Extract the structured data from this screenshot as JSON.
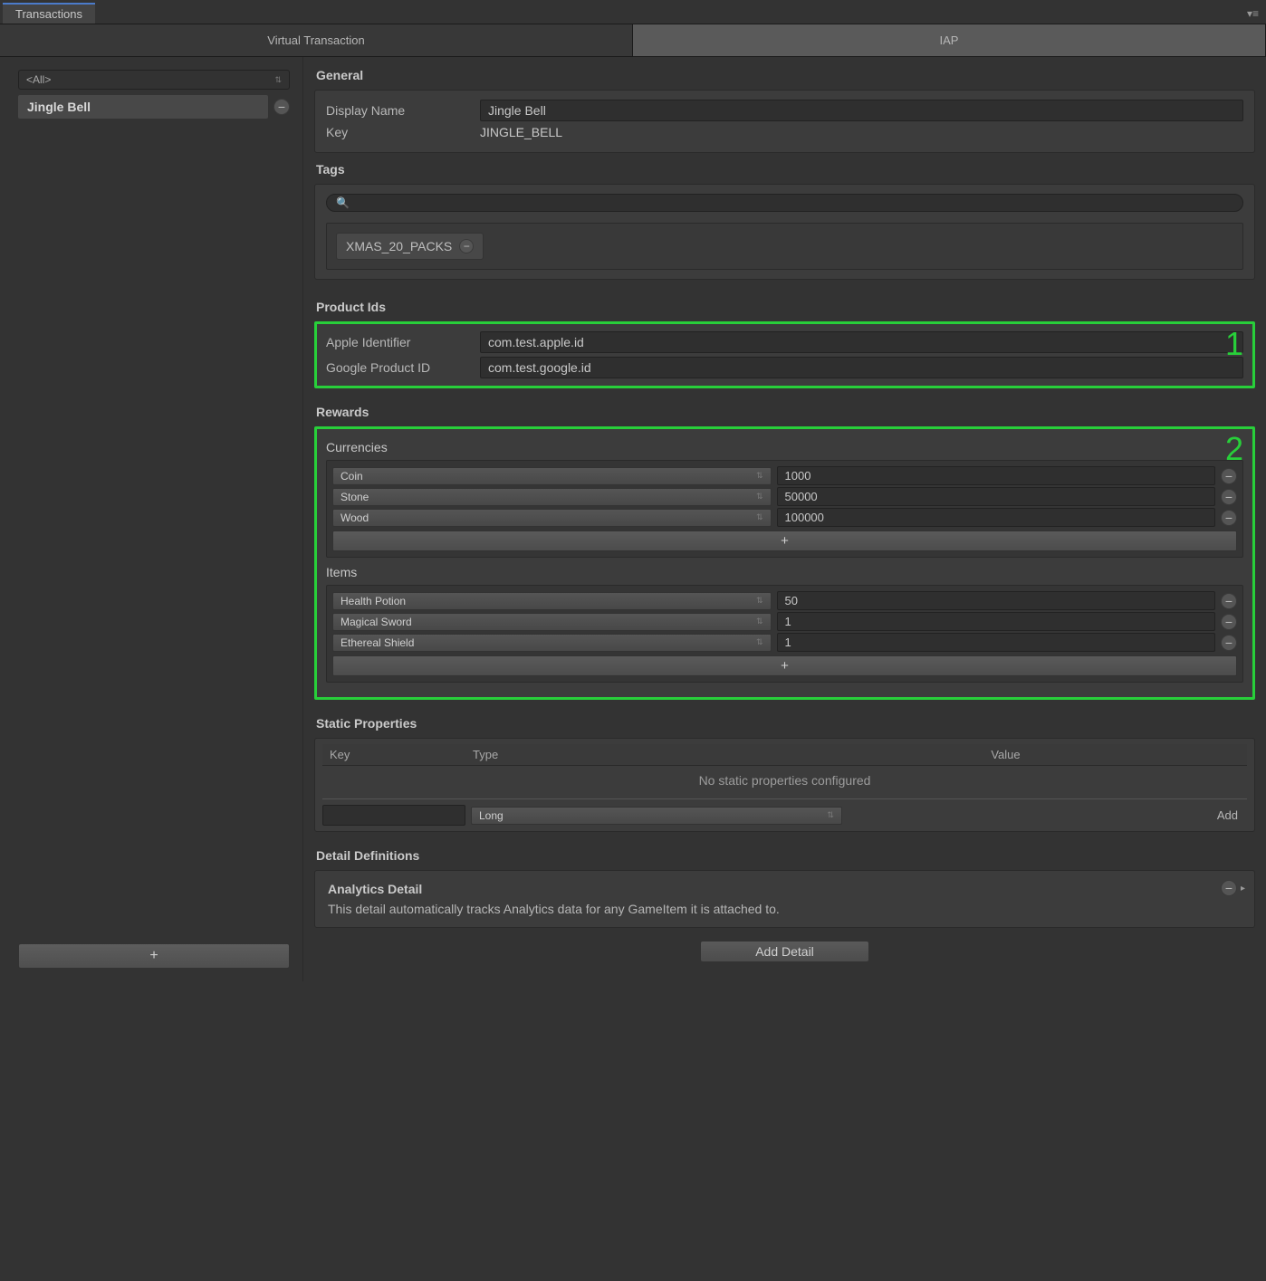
{
  "window": {
    "title": "Transactions"
  },
  "tabs": {
    "virtual": "Virtual Transaction",
    "iap": "IAP"
  },
  "sidebar": {
    "filter": "<All>",
    "items": [
      {
        "label": "Jingle Bell"
      }
    ],
    "add": "+"
  },
  "general": {
    "heading": "General",
    "display_name_label": "Display Name",
    "display_name_value": "Jingle Bell",
    "key_label": "Key",
    "key_value": "JINGLE_BELL"
  },
  "tags": {
    "heading": "Tags",
    "search_placeholder": "",
    "chips": [
      "XMAS_20_PACKS"
    ]
  },
  "product_ids": {
    "heading": "Product Ids",
    "apple_label": "Apple Identifier",
    "apple_value": "com.test.apple.id",
    "google_label": "Google Product ID",
    "google_value": "com.test.google.id",
    "highlight": "1"
  },
  "rewards": {
    "heading": "Rewards",
    "highlight": "2",
    "currencies_heading": "Currencies",
    "currencies": [
      {
        "name": "Coin",
        "amount": "1000"
      },
      {
        "name": "Stone",
        "amount": "50000"
      },
      {
        "name": "Wood",
        "amount": "100000"
      }
    ],
    "items_heading": "Items",
    "items": [
      {
        "name": "Health Potion",
        "amount": "50"
      },
      {
        "name": "Magical Sword",
        "amount": "1"
      },
      {
        "name": "Ethereal Shield",
        "amount": "1"
      }
    ],
    "add": "+"
  },
  "static_props": {
    "heading": "Static Properties",
    "col_key": "Key",
    "col_type": "Type",
    "col_value": "Value",
    "empty": "No static properties configured",
    "type_value": "Long",
    "add": "Add"
  },
  "detail_defs": {
    "heading": "Detail Definitions",
    "title": "Analytics Detail",
    "desc": "This detail automatically tracks Analytics data for any GameItem it is attached to.",
    "add_detail": "Add Detail"
  }
}
